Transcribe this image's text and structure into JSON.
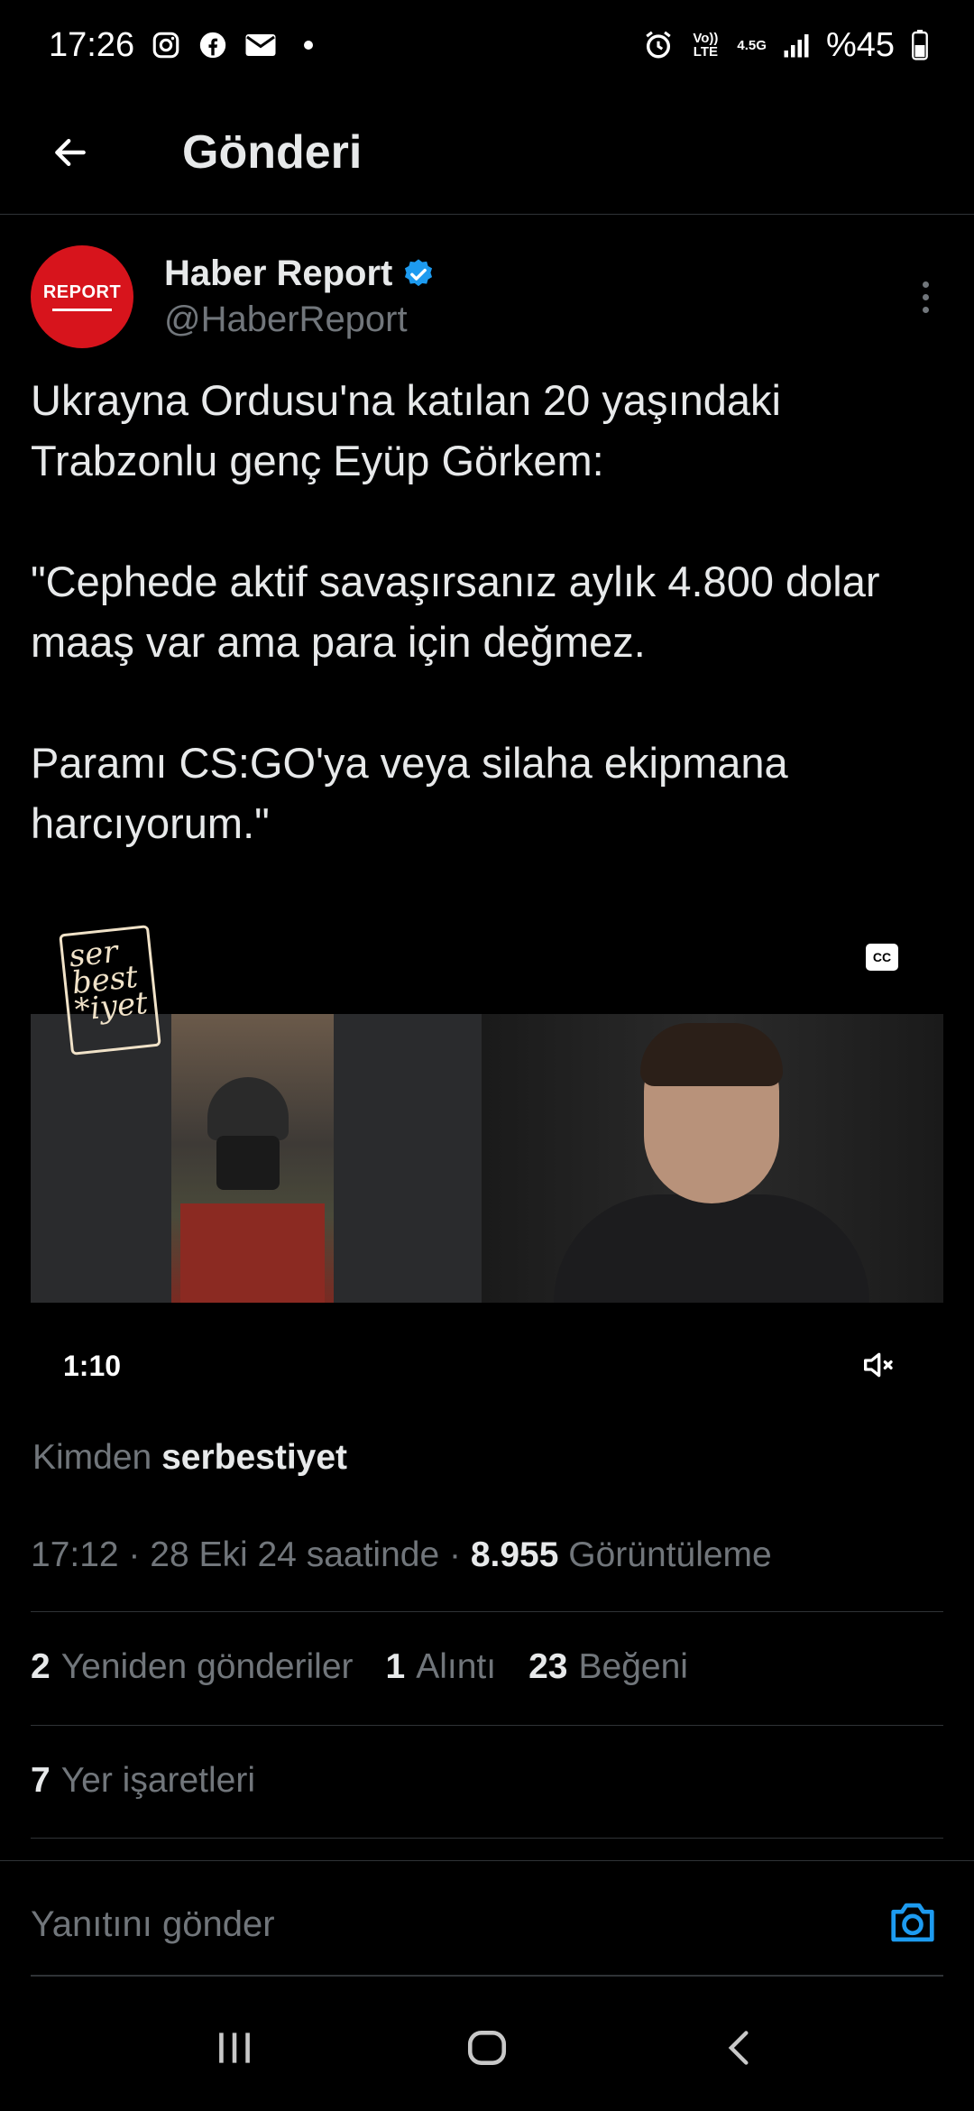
{
  "status_bar": {
    "time": "17:26",
    "battery": "%45",
    "volte": "Vo)) LTE",
    "network": "4.5G"
  },
  "header": {
    "title": "Gönderi"
  },
  "author": {
    "avatar_text": "REPORT",
    "name": "Haber Report",
    "handle": "@HaberReport"
  },
  "tweet": {
    "lines": [
      "Ukrayna Ordusu'na katılan 20 yaşındaki Trabzonlu genç Eyüp Görkem:",
      "\"Cephede aktif savaşırsanız aylık 4.800 dolar maaş var ama para için değmez.",
      "Paramı CS:GO'ya veya silaha ekipmana harcıyorum.\""
    ]
  },
  "video": {
    "logo_lines": [
      "ser",
      "best",
      "*iyet"
    ],
    "cc_label": "CC",
    "duration": "1:10"
  },
  "source": {
    "label": "Kimden",
    "name": "serbestiyet"
  },
  "meta": {
    "time_date": "17:12 · 28 Eki 24 saatinde ·",
    "views_count": "8.955",
    "views_label": "Görüntüleme"
  },
  "stats": {
    "reposts_count": "2",
    "reposts_label": "Yeniden gönderiler",
    "quotes_count": "1",
    "quotes_label": "Alıntı",
    "likes_count": "23",
    "likes_label": "Beğeni",
    "bookmarks_count": "7",
    "bookmarks_label": "Yer işaretleri"
  },
  "reply": {
    "placeholder": "Yanıtını gönder"
  },
  "colors": {
    "accent": "#1d9bf0",
    "avatar": "#d7141c",
    "muted": "#71767b"
  }
}
